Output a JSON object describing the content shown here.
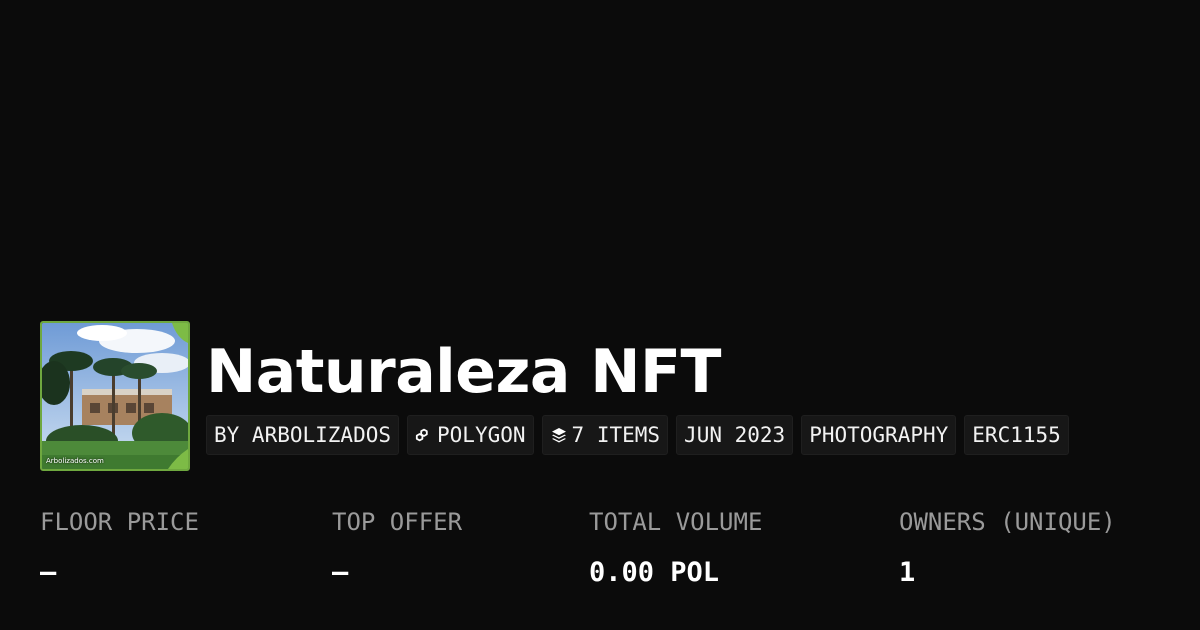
{
  "collection": {
    "title": "Naturaleza NFT",
    "thumbnail_caption": "Arbolizados.com"
  },
  "tags": {
    "creator": "BY ARBOLIZADOS",
    "chain": "POLYGON",
    "items": "7 ITEMS",
    "date": "JUN 2023",
    "category": "PHOTOGRAPHY",
    "standard": "ERC1155"
  },
  "stats": {
    "floor_price": {
      "label": "FLOOR PRICE",
      "value": "—"
    },
    "top_offer": {
      "label": "TOP OFFER",
      "value": "—"
    },
    "total_volume": {
      "label": "TOTAL VOLUME",
      "value": "0.00 POL"
    },
    "owners": {
      "label": "OWNERS (UNIQUE)",
      "value": "1"
    }
  },
  "icons": {
    "chain": "polygon-icon",
    "items": "layers-icon"
  },
  "colors": {
    "background": "#0b0b0b",
    "tag_background": "#171717",
    "label_text": "#9a9a9a",
    "value_text": "#ffffff"
  }
}
